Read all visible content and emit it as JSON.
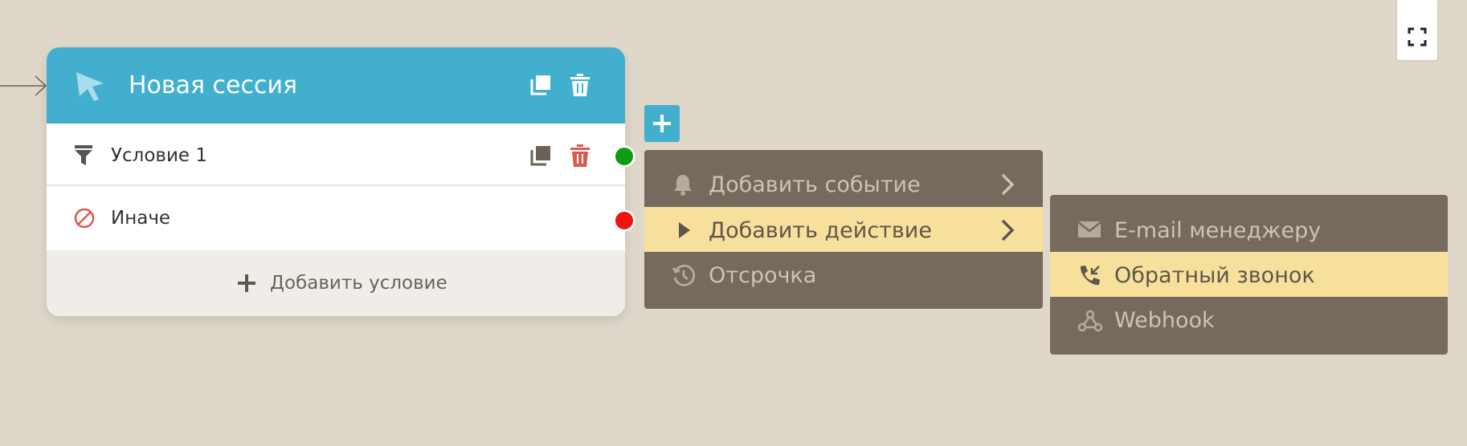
{
  "toolbar": {
    "fullscreen_icon": "fullscreen-icon"
  },
  "node": {
    "title": "Новая сессия",
    "header_icon": "cursor-icon",
    "conditions": [
      {
        "label": "Условие 1",
        "icon": "filter-icon",
        "output_color": "#0e9c12"
      }
    ],
    "else_row": {
      "label": "Иначе",
      "icon": "forbidden-icon",
      "output_color": "#ee1411"
    },
    "add_condition_label": "Добавить условие"
  },
  "add_button": {
    "label": "+"
  },
  "menu": {
    "items": [
      {
        "label": "Добавить событие",
        "icon": "bell-icon",
        "has_submenu": true,
        "highlighted": false
      },
      {
        "label": "Добавить действие",
        "icon": "play-icon",
        "has_submenu": true,
        "highlighted": true
      },
      {
        "label": "Отсрочка",
        "icon": "history-icon",
        "has_submenu": false,
        "highlighted": false
      }
    ]
  },
  "submenu": {
    "items": [
      {
        "label": "E-mail менеджеру",
        "icon": "envelope-icon",
        "highlighted": false
      },
      {
        "label": "Обратный звонок",
        "icon": "phone-callback-icon",
        "highlighted": true
      },
      {
        "label": "Webhook",
        "icon": "webhook-icon",
        "highlighted": false
      }
    ]
  },
  "colors": {
    "canvas": "#dfd7ca",
    "header": "#42afcf",
    "menu_bg": "#756a5d",
    "menu_highlight": "#f7e09b",
    "delete_red": "#dc5a4b"
  }
}
